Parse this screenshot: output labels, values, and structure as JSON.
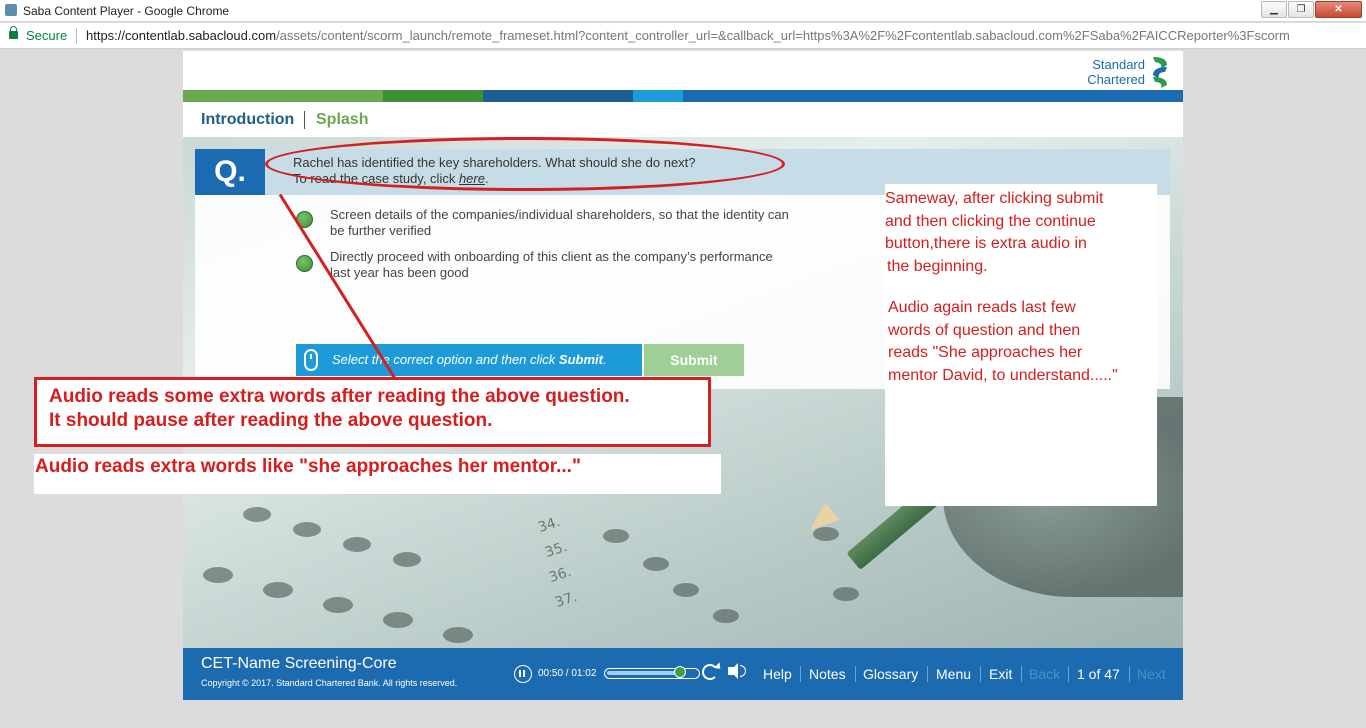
{
  "browser": {
    "window_title": "Saba Content Player - Google Chrome",
    "secure_label": "Secure",
    "url_host": "https://contentlab.sabacloud.com",
    "url_rest": "/assets/content/scorm_launch/remote_frameset.html?content_controller_url=&callback_url=https%3A%2F%2Fcontentlab.sabacloud.com%2FSaba%2FAICCReporter%3Fscorm",
    "controls": {
      "minimize": "▁",
      "maximize": "❐",
      "close": "✕"
    }
  },
  "brand": {
    "line1": "Standard",
    "line2": "Chartered",
    "colors": [
      "#6aa84f",
      "#3f8f35",
      "#1c6bb0",
      "#1c9bd8",
      "#1e5f86"
    ]
  },
  "nav": {
    "intro": "Introduction",
    "splash": "Splash"
  },
  "question": {
    "badge": "Q.",
    "line1": "Rachel has identified the key shareholders. What should she do next?",
    "line2_prefix": "To read the case study, click ",
    "line2_link": "here",
    "line2_suffix": ".",
    "options": [
      {
        "line1": "Screen details of the companies/individual shareholders, so that the identity can",
        "line2": "be further verified"
      },
      {
        "line1": "Directly proceed with onboarding of this client as the company’s performance",
        "line2": "last year has been good"
      }
    ],
    "instruction_prefix": "Select the correct option and then click ",
    "instruction_bold": "Submit",
    "instruction_suffix": ".",
    "submit_label": "Submit"
  },
  "player": {
    "course_title": "CET-Name Screening-Core",
    "copyright": "Copyright © 2017. Standard Chartered Bank. All rights reserved.",
    "time": "00:50 / 01:02",
    "progress": 0.806,
    "help": "Help",
    "notes": "Notes",
    "glossary": "Glossary",
    "menu": "Menu",
    "exit": "Exit",
    "back": "Back",
    "page": "1 of 47",
    "next": "Next"
  },
  "annotations": {
    "main_line1": "Audio reads some extra words after reading the above question.",
    "main_line2": "It should pause after reading the above question.",
    "extra": "Audio reads extra words like \"she approaches her mentor...\"",
    "side_p1": [
      "Sameway, after clicking submit",
      "and then clicking the continue",
      "button,there is extra audio in",
      "the beginning."
    ],
    "side_p2": [
      "Audio again reads last few",
      "words of question and then",
      "reads \"She approaches her",
      "mentor David, to understand.....\""
    ],
    "color": "#d71d1d"
  },
  "background_marks": [
    "34.",
    "35.",
    "36.",
    "37."
  ]
}
